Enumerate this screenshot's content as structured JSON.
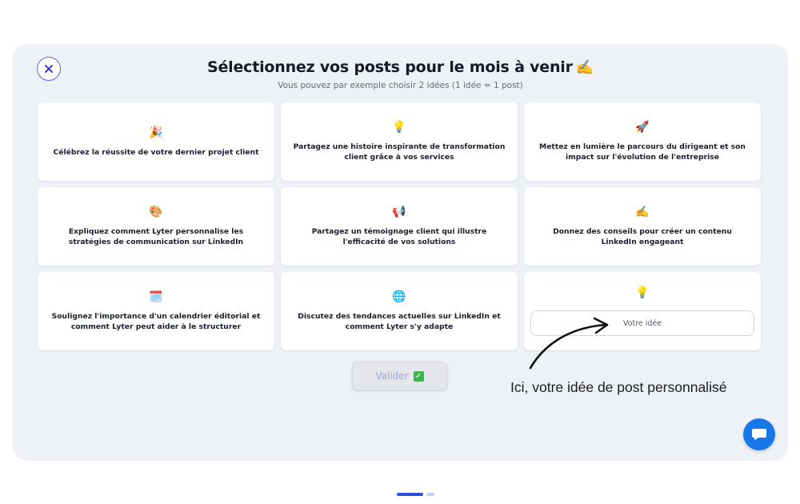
{
  "header": {
    "title": "Sélectionnez vos posts pour le mois à venir",
    "title_emoji": "✍️",
    "subtitle": "Vous pouvez par exemple choisir 2 idées (1 idée = 1 post)"
  },
  "cards": [
    {
      "icon": "party-popper-icon",
      "emoji": "🎉",
      "text": "Célébrez la réussite de votre dernier projet client"
    },
    {
      "icon": "lightbulb-icon",
      "emoji": "💡",
      "text": "Partagez une histoire inspirante de transformation client grâce à vos services"
    },
    {
      "icon": "rocket-icon",
      "emoji": "🚀",
      "text": "Mettez en lumière le parcours du dirigeant et son impact sur l'évolution de l'entreprise"
    },
    {
      "icon": "palette-icon",
      "emoji": "🎨",
      "text": "Expliquez comment Lyter personnalise les stratégies de communication sur LinkedIn"
    },
    {
      "icon": "megaphone-icon",
      "emoji": "📢",
      "text": "Partagez un témoignage client qui illustre l'efficacité de vos solutions"
    },
    {
      "icon": "writing-hand-icon",
      "emoji": "✍️",
      "text": "Donnez des conseils pour créer un contenu LinkedIn engageant"
    },
    {
      "icon": "calendar-icon",
      "emoji": "🗓️",
      "text": "Soulignez l'importance d'un calendrier éditorial et comment Lyter peut aider à le structurer"
    },
    {
      "icon": "globe-icon",
      "emoji": "🌐",
      "text": "Discutez des tendances actuelles sur LinkedIn et comment Lyter s'y adapte"
    }
  ],
  "custom_idea": {
    "icon": "lightbulb-icon",
    "emoji": "💡",
    "placeholder": "Votre idée"
  },
  "validate_button": {
    "label": "Valider",
    "icon": "check-mark-icon",
    "glyph": "✓"
  },
  "annotation": "Ici, votre idée de post personnalisé",
  "pagination": {
    "pages": 2,
    "current": 1
  },
  "colors": {
    "panel_bg": "#eef1f6",
    "accent": "#5b5fe0",
    "active_dot": "#2d4fe0",
    "chat_button": "#1877e8",
    "check_green": "#3eb34d"
  }
}
